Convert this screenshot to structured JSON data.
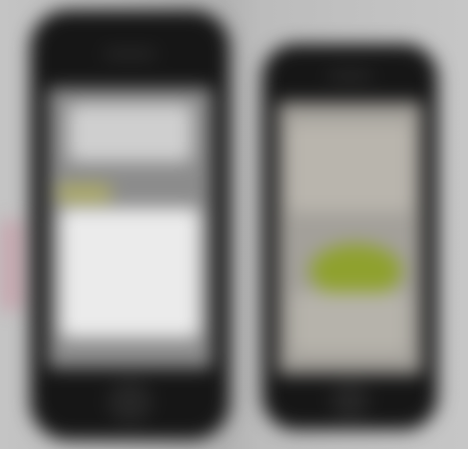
{
  "scene": {
    "subjects": [
      "smartphone-left",
      "smartphone-right"
    ],
    "colors": {
      "background": "#b8b8b8",
      "phone_body": "#161616",
      "left_screen_panel": "#ebebeb",
      "right_screen_accent": "#8fa12e",
      "pink_edge_accent": "#c892a0"
    }
  }
}
